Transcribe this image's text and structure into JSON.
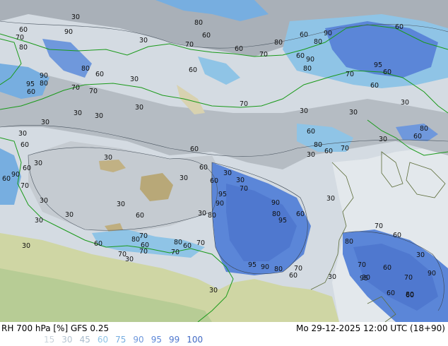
{
  "footer": {
    "title": "RH 700 hPa [%] GFS 0.25",
    "valid": "Mo 29-12-2025 12:00 UTC (18+90)"
  },
  "legend": [
    {
      "label": "15",
      "color": "#c9d3db"
    },
    {
      "label": "30",
      "color": "#b5c4d1"
    },
    {
      "label": "45",
      "color": "#a9bccd"
    },
    {
      "label": "60",
      "color": "#8fc4e6"
    },
    {
      "label": "75",
      "color": "#77aee0"
    },
    {
      "label": "90",
      "color": "#6f98dc"
    },
    {
      "label": "95",
      "color": "#5b86d8"
    },
    {
      "label": "99",
      "color": "#4f78cf"
    },
    {
      "label": "100",
      "color": "#4169c4"
    }
  ],
  "contour_labels": [
    "30",
    "60",
    "90",
    "70",
    "80",
    "30",
    "80",
    "60",
    "70",
    "60",
    "80",
    "70",
    "60",
    "80",
    "90",
    "60",
    "60",
    "90",
    "80",
    "60",
    "95",
    "60",
    "70",
    "60",
    "70",
    "60",
    "70",
    "60",
    "80",
    "95",
    "90",
    "80",
    "30",
    "70",
    "30",
    "30",
    "30",
    "30",
    "30",
    "30",
    "30",
    "30",
    "60",
    "60",
    "30",
    "80",
    "60",
    "70",
    "30",
    "60",
    "30",
    "60",
    "30",
    "30",
    "60",
    "70",
    "90",
    "60",
    "70",
    "30",
    "30",
    "30",
    "60",
    "30",
    "60",
    "30",
    "30",
    "30",
    "70",
    "95",
    "90",
    "80",
    "30",
    "90",
    "80",
    "95",
    "60",
    "30",
    "60",
    "70",
    "80",
    "30",
    "60",
    "30",
    "60",
    "80",
    "70",
    "70",
    "70",
    "80",
    "60",
    "70",
    "95",
    "90",
    "80",
    "70",
    "60",
    "30",
    "30",
    "70",
    "60",
    "30",
    "95",
    "70",
    "60",
    "90",
    "60",
    "80",
    "60",
    "80",
    "30",
    "30"
  ]
}
